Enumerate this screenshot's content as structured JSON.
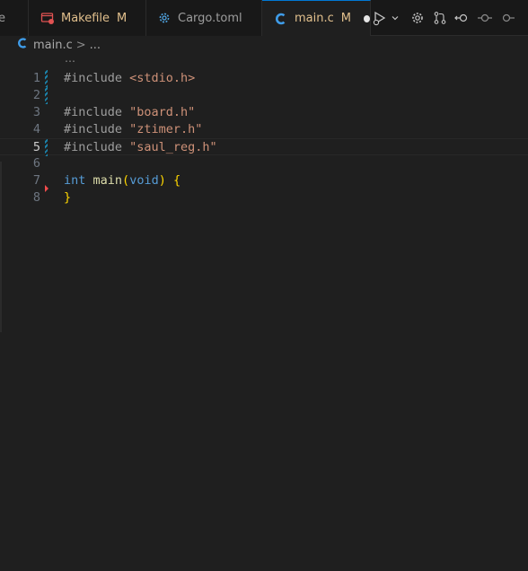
{
  "tabs": [
    {
      "label": "e",
      "icon": "",
      "badge": "",
      "active": false
    },
    {
      "label": "Makefile",
      "icon": "makefile-icon",
      "badge": "M",
      "active": false
    },
    {
      "label": "Cargo.toml",
      "icon": "gear-icon",
      "badge": "",
      "active": false
    },
    {
      "label": "main.c",
      "icon": "c-file-icon",
      "badge": "M",
      "active": true,
      "dirty": true
    }
  ],
  "toolbar": {
    "actions": [
      "run-debug-icon",
      "chevron-down-icon",
      "settings-icon",
      "source-control-icon",
      "go-back-icon",
      "go-forward-icon"
    ]
  },
  "breadcrumb": {
    "file": "main.c",
    "separator": ">",
    "more": "..."
  },
  "sticky": "…",
  "editor": {
    "current_line": 5,
    "lines": [
      {
        "number": "1",
        "gutter": "modified",
        "tokens": [
          {
            "t": "#include ",
            "c": "inc"
          },
          {
            "t": "<stdio.h>",
            "c": "str"
          }
        ]
      },
      {
        "number": "2",
        "gutter": "modified",
        "tokens": []
      },
      {
        "number": "3",
        "gutter": "",
        "tokens": [
          {
            "t": "#include ",
            "c": "inc"
          },
          {
            "t": "\"board.h\"",
            "c": "str"
          }
        ]
      },
      {
        "number": "4",
        "gutter": "",
        "tokens": [
          {
            "t": "#include ",
            "c": "inc"
          },
          {
            "t": "\"ztimer.h\"",
            "c": "str"
          }
        ]
      },
      {
        "number": "5",
        "gutter": "modified",
        "tokens": [
          {
            "t": "#include ",
            "c": "inc"
          },
          {
            "t": "\"saul_reg.h\"",
            "c": "str"
          }
        ]
      },
      {
        "number": "6",
        "gutter": "",
        "tokens": []
      },
      {
        "number": "7",
        "gutter": "deleted",
        "tokens": [
          {
            "t": "int",
            "c": "kw"
          },
          {
            "t": " ",
            "c": ""
          },
          {
            "t": "main",
            "c": "fn"
          },
          {
            "t": "(",
            "c": "brk"
          },
          {
            "t": "void",
            "c": "kw"
          },
          {
            "t": ")",
            "c": "brk"
          },
          {
            "t": " ",
            "c": ""
          },
          {
            "t": "{",
            "c": "brk"
          }
        ]
      },
      {
        "number": "8",
        "gutter": "",
        "tokens": [
          {
            "t": "}",
            "c": "brk"
          }
        ]
      }
    ]
  },
  "colors": {
    "background": "#1f1f1f",
    "accent": "#0078d4",
    "modified": "#e2c08d",
    "gutter_modified": "#1b81a8",
    "gutter_deleted": "#f14c4c"
  }
}
